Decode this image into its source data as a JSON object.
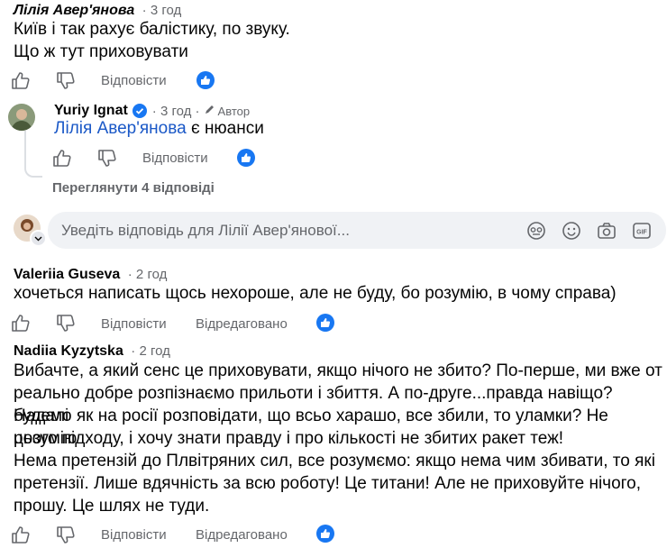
{
  "comments": [
    {
      "author": "Лілія Авер'янова",
      "time": "· 3 год",
      "lines": [
        "Київ і так рахує балістику, по звуку.",
        "Що ж тут приховувати"
      ],
      "actions": {
        "reply": "Відповісти"
      }
    },
    {
      "author": "Valeriia Guseva",
      "time": "· 2 год",
      "lines": [
        "хочеться написать щось нехороше, але не буду, бо розумію, в чому справа)"
      ],
      "actions": {
        "reply": "Відповісти",
        "edited": "Відредаговано"
      }
    },
    {
      "author": "Nadiia Kyzytska",
      "time": "· 2 год",
      "lines": [
        "Вибачте, а який сенс це приховувати, якщо нічого не збито? По-перше, ми вже от",
        "реально добре розпізнаємо прильоти і збиття. А по-друге...правда навіщо? Надалі",
        "будемо як на росії розповідати, що всьо харашо, все збили, то уламки? Не розумію",
        "цього підходу, і хочу знати правду і про кількості не збитих ракет теж!",
        "Нема претензій до Плвітряних сил, все розумємо: якщо нема чим збивати, то які",
        "претензії. Лише вдячність за всю роботу! Це титани! Але не приховуйте нічого,",
        "прошу. Це шлях не туди."
      ],
      "actions": {
        "reply": "Відповісти",
        "edited": "Відредаговано"
      }
    }
  ],
  "reply": {
    "author": "Yuriy Ignat",
    "time": "· 3 год ·",
    "author_badge": "Автор",
    "mention": "Лілія Авер'янова",
    "text": " є нюанси",
    "actions": {
      "reply": "Відповісти"
    }
  },
  "view_replies": "Переглянути 4 відповіді",
  "reply_input": {
    "placeholder": "Уведіть відповідь для Лілії Авер'янової..."
  },
  "icons": {
    "like": "thumbs-up-icon",
    "dislike": "thumbs-down-icon",
    "reaction": "like-reaction-icon",
    "verified": "verified-badge-icon",
    "avatar_sticker": "sticker-icon",
    "emoji": "emoji-icon",
    "camera": "camera-icon",
    "gif": "gif-icon"
  },
  "colors": {
    "accent": "#1877f2",
    "mention": "#1a58c7",
    "muted": "#65676b",
    "input_bg": "#f0f2f5"
  }
}
